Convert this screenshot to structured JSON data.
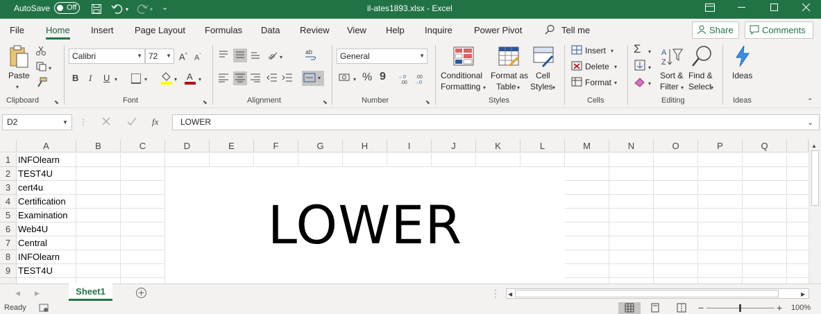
{
  "titlebar": {
    "autosave_label": "AutoSave",
    "autosave_state": "Off",
    "filename": "il-ates1893.xlsx",
    "separator": " - ",
    "app_name": "Excel"
  },
  "tabs": [
    {
      "label": "File"
    },
    {
      "label": "Home"
    },
    {
      "label": "Insert"
    },
    {
      "label": "Page Layout"
    },
    {
      "label": "Formulas"
    },
    {
      "label": "Data"
    },
    {
      "label": "Review"
    },
    {
      "label": "View"
    },
    {
      "label": "Help"
    },
    {
      "label": "Inquire"
    },
    {
      "label": "Power Pivot"
    }
  ],
  "tell_me": "Tell me",
  "share_label": "Share",
  "comments_label": "Comments",
  "ribbon": {
    "clipboard": {
      "paste": "Paste",
      "group": "Clipboard"
    },
    "font": {
      "name": "Calibri",
      "size": "72",
      "group": "Font",
      "bold": "B",
      "italic": "I",
      "underline": "U"
    },
    "alignment": {
      "group": "Alignment"
    },
    "number": {
      "format": "General",
      "group": "Number",
      "percent": "%",
      "comma": "9",
      "inc_dec": "←0\n.00",
      "dec_dec": ".00\n→0"
    },
    "styles": {
      "conditional_1": "Conditional",
      "conditional_2": "Formatting",
      "format_table_1": "Format as",
      "format_table_2": "Table",
      "cell_styles_1": "Cell",
      "cell_styles_2": "Styles",
      "group": "Styles"
    },
    "cells": {
      "insert": "Insert",
      "delete": "Delete",
      "format": "Format",
      "group": "Cells"
    },
    "editing": {
      "sort_1": "Sort &",
      "sort_2": "Filter",
      "find_1": "Find &",
      "find_2": "Select",
      "group": "Editing"
    },
    "ideas": {
      "label": "Ideas",
      "group": "Ideas"
    }
  },
  "formula_bar": {
    "name_box": "D2",
    "fx": "fx",
    "value": "LOWER"
  },
  "columns": [
    "A",
    "B",
    "C",
    "D",
    "E",
    "F",
    "G",
    "H",
    "I",
    "J",
    "K",
    "L",
    "M",
    "N",
    "O",
    "P",
    "Q"
  ],
  "rows": [
    "1",
    "2",
    "3",
    "4",
    "5",
    "6",
    "7",
    "8",
    "9"
  ],
  "cells_a": [
    "INFOlearn",
    "TEST4U",
    "cert4u",
    "Certification",
    "Examination",
    "Web4U",
    "Central",
    "INFOlearn",
    "TEST4U"
  ],
  "merged_cell_text": "LOWER",
  "sheet_tab": "Sheet1",
  "status": {
    "ready": "Ready",
    "zoom": "100%"
  },
  "colors": {
    "brand": "#217346",
    "ribbon_bg": "#f3f2f1"
  }
}
